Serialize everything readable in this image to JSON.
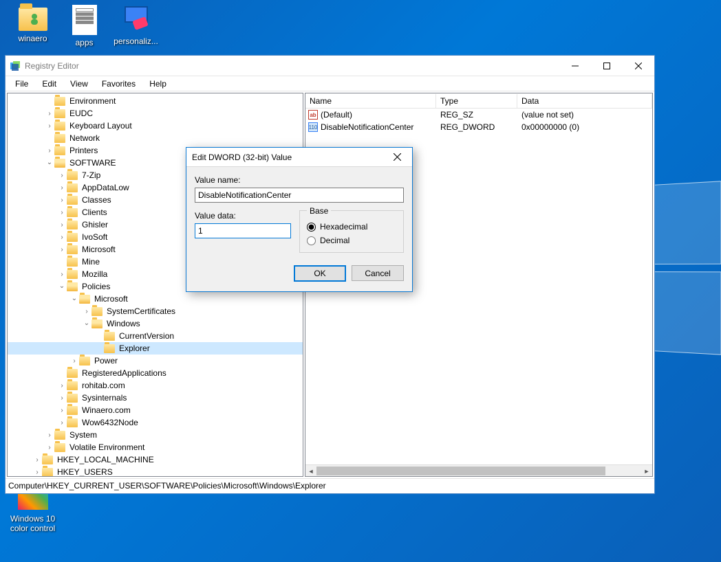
{
  "desktop": {
    "icons": [
      "winaero",
      "apps",
      "personaliz...",
      "Windows 10",
      "color control"
    ]
  },
  "window": {
    "title": "Registry Editor",
    "menu": [
      "File",
      "Edit",
      "View",
      "Favorites",
      "Help"
    ],
    "status": "Computer\\HKEY_CURRENT_USER\\SOFTWARE\\Policies\\Microsoft\\Windows\\Explorer",
    "cols": {
      "name": "Name",
      "type": "Type",
      "data": "Data"
    },
    "rows": [
      {
        "icon": "sz",
        "name": "(Default)",
        "type": "REG_SZ",
        "data": "(value not set)"
      },
      {
        "icon": "dw",
        "name": "DisableNotificationCenter",
        "type": "REG_DWORD",
        "data": "0x00000000 (0)"
      }
    ],
    "tree": [
      {
        "d": 3,
        "e": "leaf",
        "l": "Environment"
      },
      {
        "d": 3,
        "e": "col",
        "l": "EUDC"
      },
      {
        "d": 3,
        "e": "col",
        "l": "Keyboard Layout"
      },
      {
        "d": 3,
        "e": "leaf",
        "l": "Network"
      },
      {
        "d": 3,
        "e": "col",
        "l": "Printers"
      },
      {
        "d": 3,
        "e": "exp",
        "l": "SOFTWARE",
        "open": true
      },
      {
        "d": 4,
        "e": "col",
        "l": "7-Zip"
      },
      {
        "d": 4,
        "e": "col",
        "l": "AppDataLow"
      },
      {
        "d": 4,
        "e": "col",
        "l": "Classes"
      },
      {
        "d": 4,
        "e": "col",
        "l": "Clients"
      },
      {
        "d": 4,
        "e": "col",
        "l": "Ghisler"
      },
      {
        "d": 4,
        "e": "col",
        "l": "IvoSoft"
      },
      {
        "d": 4,
        "e": "col",
        "l": "Microsoft"
      },
      {
        "d": 4,
        "e": "leaf",
        "l": "Mine"
      },
      {
        "d": 4,
        "e": "col",
        "l": "Mozilla"
      },
      {
        "d": 4,
        "e": "exp",
        "l": "Policies",
        "open": true
      },
      {
        "d": 5,
        "e": "exp",
        "l": "Microsoft",
        "open": true
      },
      {
        "d": 6,
        "e": "col",
        "l": "SystemCertificates"
      },
      {
        "d": 6,
        "e": "exp",
        "l": "Windows",
        "open": true
      },
      {
        "d": 7,
        "e": "leaf",
        "l": "CurrentVersion"
      },
      {
        "d": 7,
        "e": "leaf",
        "l": "Explorer",
        "sel": true
      },
      {
        "d": 5,
        "e": "col",
        "l": "Power"
      },
      {
        "d": 4,
        "e": "leaf",
        "l": "RegisteredApplications"
      },
      {
        "d": 4,
        "e": "col",
        "l": "rohitab.com"
      },
      {
        "d": 4,
        "e": "col",
        "l": "Sysinternals"
      },
      {
        "d": 4,
        "e": "col",
        "l": "Winaero.com"
      },
      {
        "d": 4,
        "e": "col",
        "l": "Wow6432Node"
      },
      {
        "d": 3,
        "e": "col",
        "l": "System"
      },
      {
        "d": 3,
        "e": "col",
        "l": "Volatile Environment"
      },
      {
        "d": 2,
        "e": "col",
        "l": "HKEY_LOCAL_MACHINE"
      },
      {
        "d": 2,
        "e": "col",
        "l": "HKEY_USERS"
      }
    ]
  },
  "dialog": {
    "title": "Edit DWORD (32-bit) Value",
    "lblName": "Value name:",
    "name": "DisableNotificationCenter",
    "lblData": "Value data:",
    "data": "1",
    "grpBase": "Base",
    "optHex": "Hexadecimal",
    "optDec": "Decimal",
    "ok": "OK",
    "cancel": "Cancel"
  }
}
